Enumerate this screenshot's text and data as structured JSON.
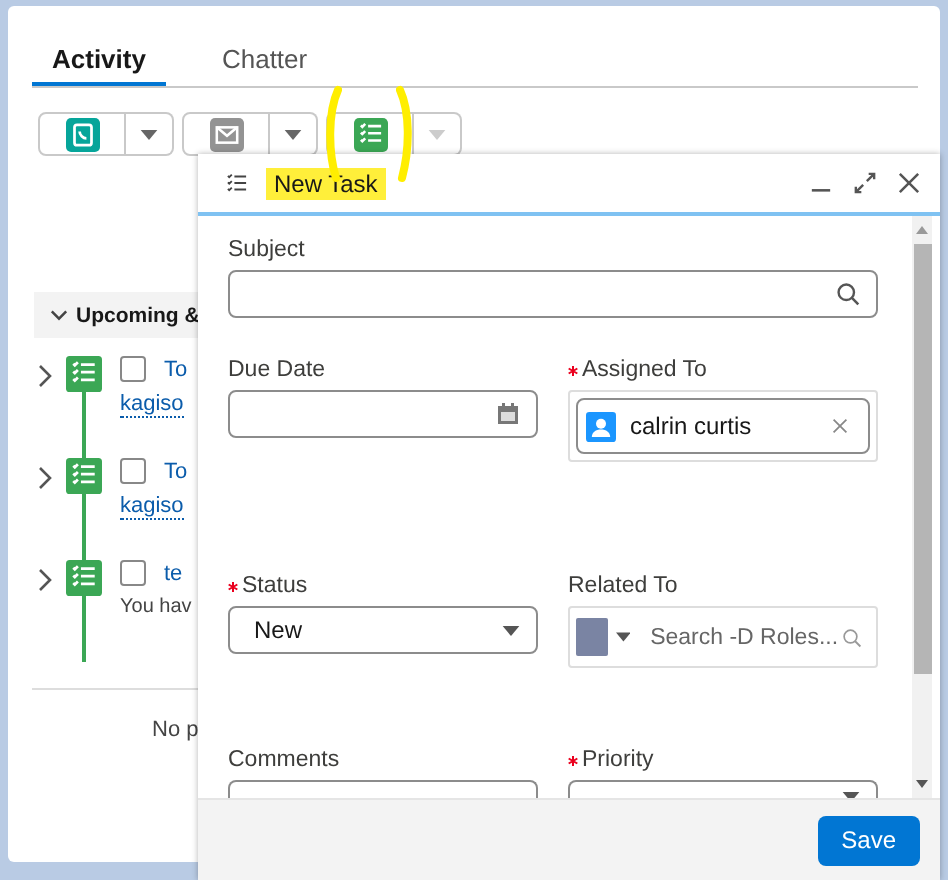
{
  "tabs": [
    {
      "label": "Activity",
      "selected": true
    },
    {
      "label": "Chatter",
      "selected": false
    }
  ],
  "actions": [
    {
      "kind": "call",
      "color": "#06a59a",
      "dropdown_disabled": false
    },
    {
      "kind": "email",
      "color": "#939393",
      "dropdown_disabled": false
    },
    {
      "kind": "task",
      "color": "#3ba755",
      "dropdown_disabled": true
    }
  ],
  "timeline": {
    "header": "Upcoming &",
    "expanded": true,
    "items": [
      {
        "title": "To",
        "checked": false,
        "link": "kagiso"
      },
      {
        "title": "To",
        "checked": false,
        "link": "kagiso"
      },
      {
        "title": "te",
        "checked": false,
        "note": "You hav"
      }
    ],
    "footer": "No p"
  },
  "composer": {
    "title": "New Task",
    "fields": [
      {
        "kind": "search",
        "label": "Subject",
        "required": false
      },
      {
        "kind": "date",
        "label": "Due Date",
        "required": false
      },
      {
        "kind": "user",
        "label": "Assigned To",
        "required": true,
        "value": "calrin curtis"
      },
      {
        "kind": "select",
        "label": "Status",
        "required": true,
        "value": "New"
      },
      {
        "kind": "related",
        "label": "Related To",
        "required": false,
        "placeholder": "Search -D Roles..."
      },
      {
        "kind": "text",
        "label": "Comments",
        "required": false
      },
      {
        "kind": "select",
        "label": "Priority",
        "required": true
      }
    ],
    "save": "Save"
  }
}
